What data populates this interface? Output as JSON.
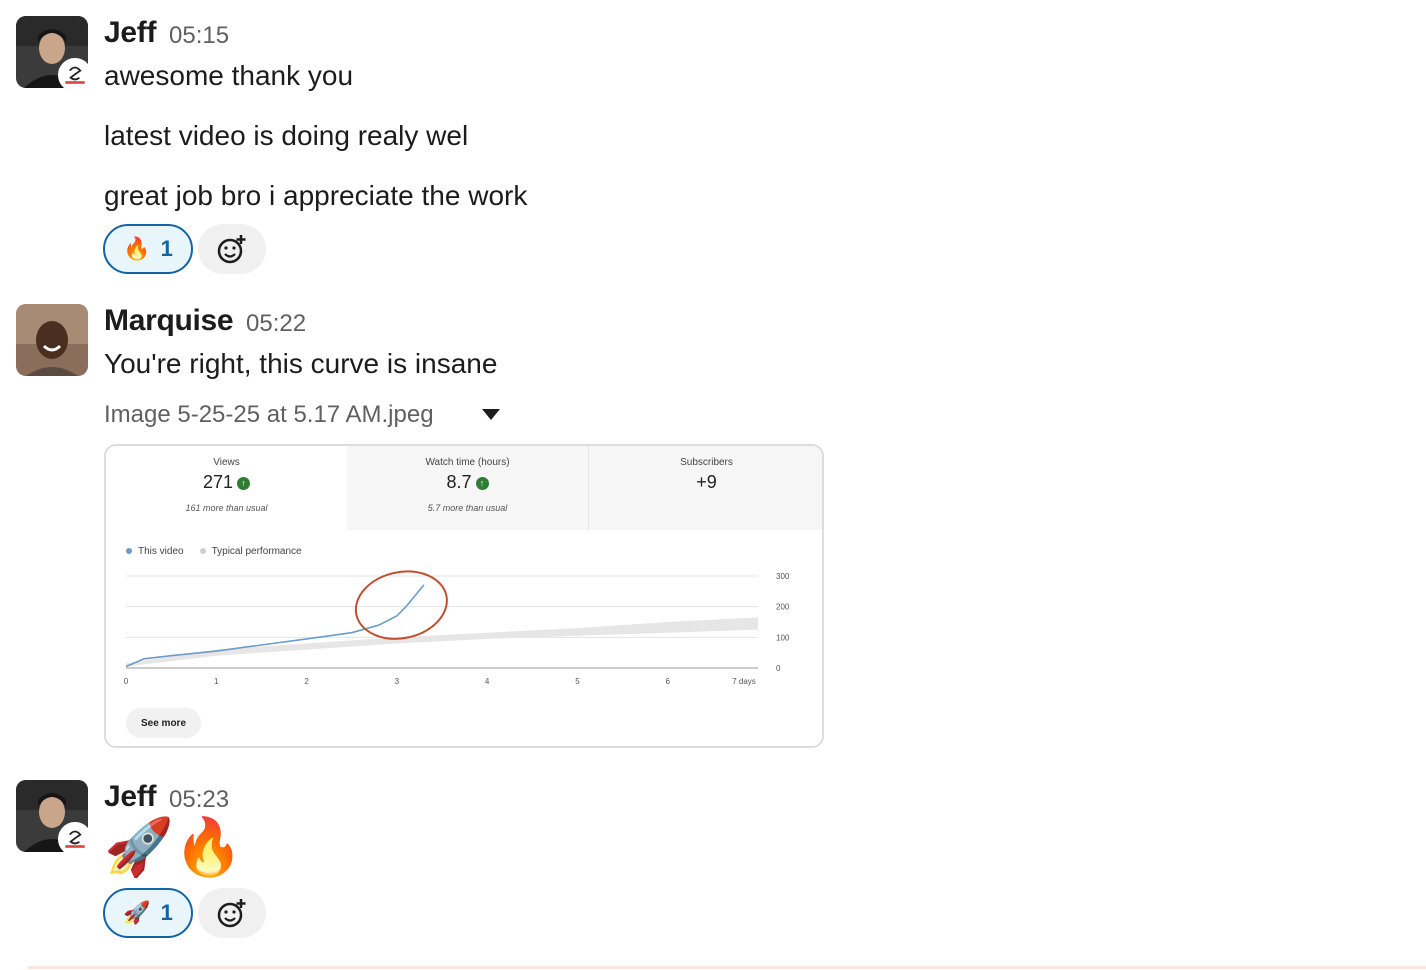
{
  "messages": [
    {
      "author": "Jeff",
      "time": "05:15",
      "lines": [
        "awesome thank you",
        "latest video is doing realy wel",
        "great job bro i appreciate the work"
      ],
      "reaction": {
        "emoji": "🔥",
        "count": "1"
      }
    },
    {
      "author": "Marquise",
      "time": "05:22",
      "lines": [
        "You're right, this curve is insane"
      ],
      "attachment": {
        "file_name": "Image 5-25-25 at 5.17 AM.jpeg",
        "stats": [
          {
            "label": "Views",
            "value": "271",
            "sub": "161 more than usual",
            "trend": "up"
          },
          {
            "label": "Watch time (hours)",
            "value": "8.7",
            "sub": "5.7 more than usual",
            "trend": "up"
          },
          {
            "label": "Subscribers",
            "value": "+9",
            "sub": "",
            "trend": "none"
          }
        ],
        "legend": [
          "This video",
          "Typical performance"
        ],
        "see_more_label": "See more"
      }
    },
    {
      "author": "Jeff",
      "time": "05:23",
      "emojis": "🚀🔥",
      "reaction": {
        "emoji": "🚀",
        "count": "1"
      }
    }
  ],
  "chart_data": {
    "type": "line",
    "title": "",
    "xlabel": "",
    "ylabel": "",
    "x_ticks": [
      "0",
      "1",
      "2",
      "3",
      "4",
      "5",
      "6",
      "7 days"
    ],
    "y_ticks": [
      "0",
      "100",
      "200",
      "300"
    ],
    "xlim": [
      0,
      7
    ],
    "ylim": [
      0,
      300
    ],
    "grid": true,
    "legend_position": "top-left",
    "series": [
      {
        "name": "This video",
        "color": "#6b9bc8",
        "x": [
          0,
          0.2,
          0.5,
          1,
          1.5,
          2,
          2.5,
          2.8,
          3.0,
          3.1,
          3.2,
          3.3
        ],
        "y": [
          5,
          30,
          40,
          55,
          75,
          95,
          115,
          140,
          170,
          200,
          235,
          271
        ]
      },
      {
        "name": "Typical performance",
        "color": "#e6e6e6",
        "type": "band",
        "x": [
          0,
          1,
          2,
          3,
          4,
          5,
          6,
          7
        ],
        "low": [
          5,
          40,
          60,
          80,
          95,
          105,
          115,
          125
        ],
        "high": [
          15,
          60,
          80,
          100,
          115,
          130,
          150,
          165
        ]
      }
    ],
    "annotation": "red circle around the upward curve"
  },
  "colors": {
    "accent": "#1264a3",
    "reaction_bg": "#e8f5fa",
    "annotation": "#c0502f"
  }
}
